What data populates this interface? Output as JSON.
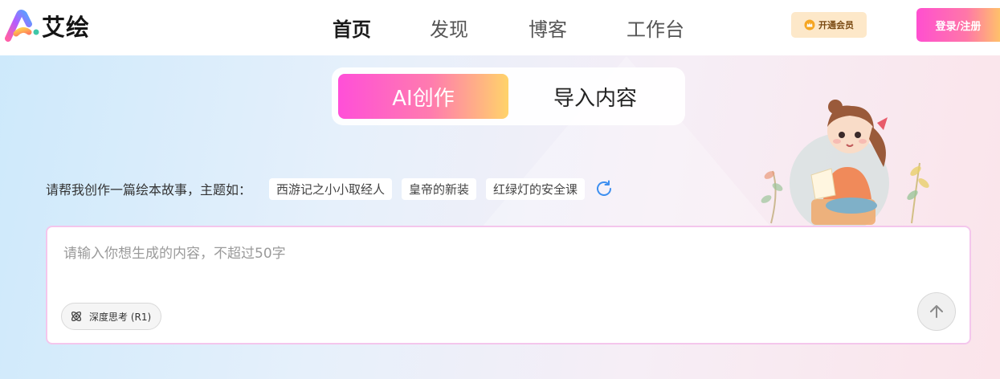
{
  "brand": {
    "name": "艾绘"
  },
  "nav": {
    "items": [
      {
        "label": "首页",
        "active": true
      },
      {
        "label": "发现",
        "active": false
      },
      {
        "label": "博客",
        "active": false
      },
      {
        "label": "工作台",
        "active": false
      }
    ]
  },
  "header": {
    "vip_label": "开通会员",
    "login_label": "登录/注册"
  },
  "modes": {
    "active_label": "AI创作",
    "inactive_label": "导入内容"
  },
  "suggestions": {
    "label": "请帮我创作一篇绘本故事，主题如：",
    "chips": [
      "西游记之小小取经人",
      "皇帝的新装",
      "红绿灯的安全课"
    ]
  },
  "composer": {
    "placeholder": "请输入你想生成的内容，不超过50字",
    "value": "",
    "deep_think_label": "深度思考 (R1)"
  },
  "colors": {
    "accent_pink": "#ff4fd8",
    "accent_orange": "#ffd36a",
    "input_border": "#f4c6ec",
    "refresh_blue": "#3d8ff0"
  },
  "icons": {
    "logo": "logo-mark-icon",
    "vip": "crown-icon",
    "refresh": "refresh-icon",
    "deep_think": "atom-icon",
    "send": "arrow-up-icon"
  }
}
